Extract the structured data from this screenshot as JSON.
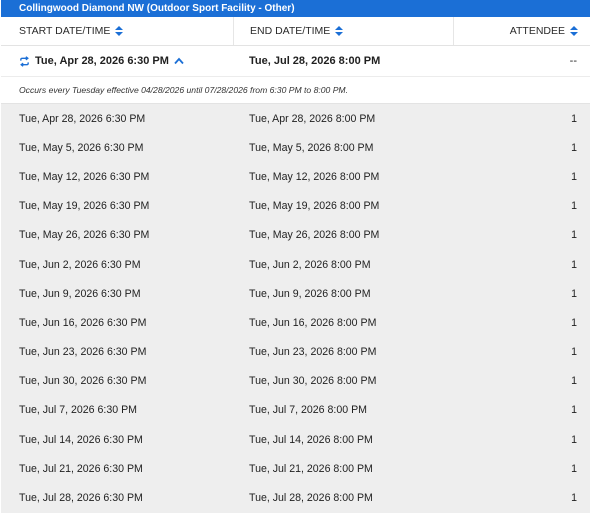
{
  "facility": {
    "title": "Collingwood Diamond NW (Outdoor Sport Facility - Other)"
  },
  "columns": {
    "start": "START DATE/TIME",
    "end": "END DATE/TIME",
    "attendee": "ATTENDEE"
  },
  "summary": {
    "start": "Tue, Apr 28, 2026 6:30 PM",
    "end": "Tue, Jul 28, 2026 8:00 PM",
    "attendee": "--",
    "recurrence_note": "Occurs every Tuesday effective 04/28/2026 until 07/28/2026 from 6:30 PM to 8:00 PM."
  },
  "occurrences": [
    {
      "start": "Tue, Apr 28, 2026 6:30 PM",
      "end": "Tue, Apr 28, 2026 8:00 PM",
      "attendee": "1"
    },
    {
      "start": "Tue, May 5, 2026 6:30 PM",
      "end": "Tue, May 5, 2026 8:00 PM",
      "attendee": "1"
    },
    {
      "start": "Tue, May 12, 2026 6:30 PM",
      "end": "Tue, May 12, 2026 8:00 PM",
      "attendee": "1"
    },
    {
      "start": "Tue, May 19, 2026 6:30 PM",
      "end": "Tue, May 19, 2026 8:00 PM",
      "attendee": "1"
    },
    {
      "start": "Tue, May 26, 2026 6:30 PM",
      "end": "Tue, May 26, 2026 8:00 PM",
      "attendee": "1"
    },
    {
      "start": "Tue, Jun 2, 2026 6:30 PM",
      "end": "Tue, Jun 2, 2026 8:00 PM",
      "attendee": "1"
    },
    {
      "start": "Tue, Jun 9, 2026 6:30 PM",
      "end": "Tue, Jun 9, 2026 8:00 PM",
      "attendee": "1"
    },
    {
      "start": "Tue, Jun 16, 2026 6:30 PM",
      "end": "Tue, Jun 16, 2026 8:00 PM",
      "attendee": "1"
    },
    {
      "start": "Tue, Jun 23, 2026 6:30 PM",
      "end": "Tue, Jun 23, 2026 8:00 PM",
      "attendee": "1"
    },
    {
      "start": "Tue, Jun 30, 2026 6:30 PM",
      "end": "Tue, Jun 30, 2026 8:00 PM",
      "attendee": "1"
    },
    {
      "start": "Tue, Jul 7, 2026 6:30 PM",
      "end": "Tue, Jul 7, 2026 8:00 PM",
      "attendee": "1"
    },
    {
      "start": "Tue, Jul 14, 2026 6:30 PM",
      "end": "Tue, Jul 14, 2026 8:00 PM",
      "attendee": "1"
    },
    {
      "start": "Tue, Jul 21, 2026 6:30 PM",
      "end": "Tue, Jul 21, 2026 8:00 PM",
      "attendee": "1"
    },
    {
      "start": "Tue, Jul 28, 2026 6:30 PM",
      "end": "Tue, Jul 28, 2026 8:00 PM",
      "attendee": "1"
    }
  ],
  "icons": {
    "sort": "sort-icon",
    "repeat": "repeat-icon",
    "collapse": "chevron-up-icon"
  },
  "colors": {
    "accent": "#1b6fd6",
    "row_background": "#eeeeee"
  }
}
